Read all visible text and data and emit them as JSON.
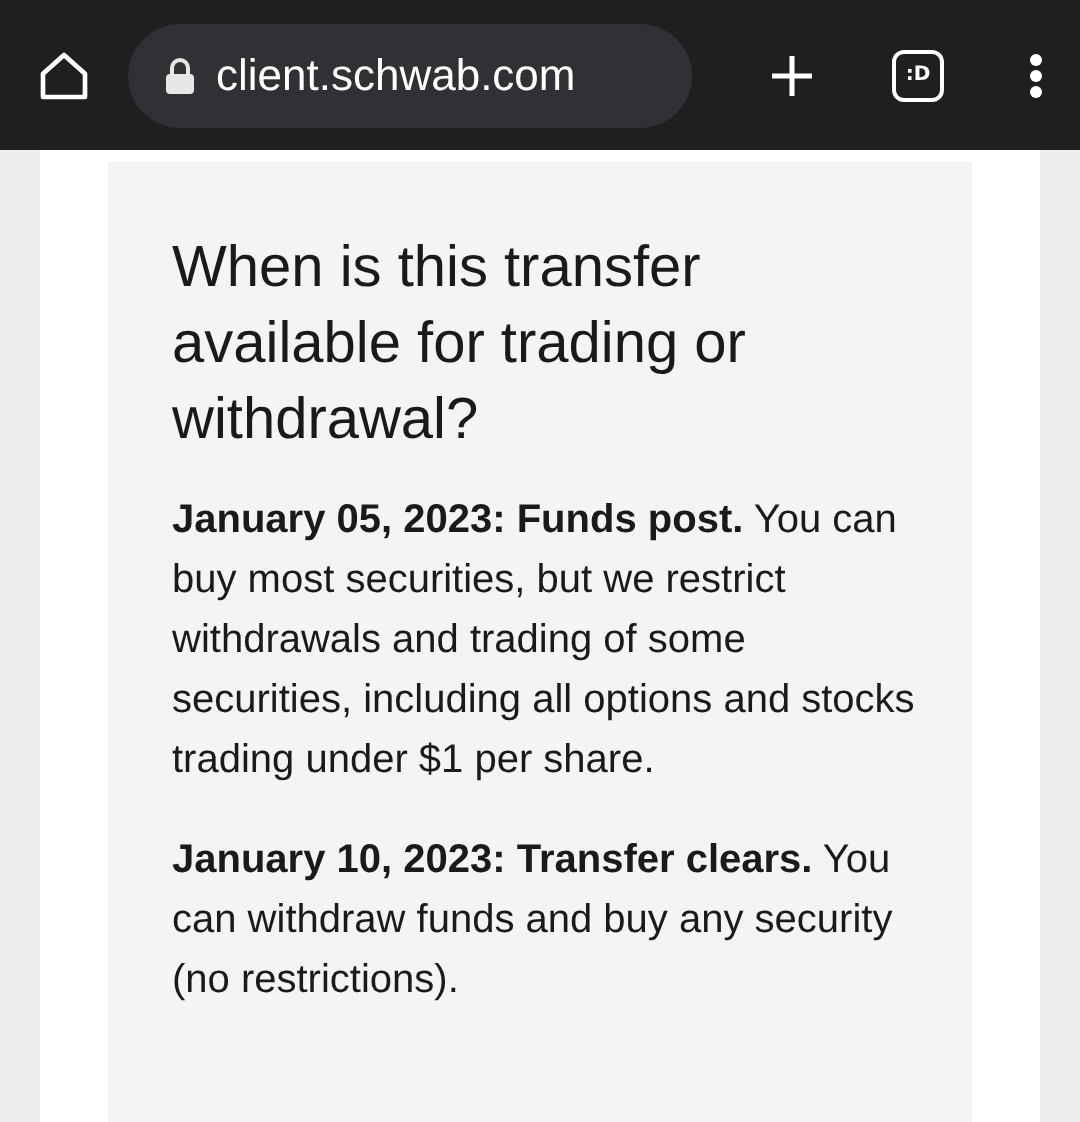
{
  "browser": {
    "url": "client.schwab.com",
    "tab_count": ":D"
  },
  "card": {
    "heading": "When is this transfer available for trading or withdrawal?",
    "paragraphs": [
      "**January 05, 2023: Funds post.** You can buy most securities, but we restrict withdrawals and trading of some securities, including all options and stocks trading under $1 per share.",
      "**January 10, 2023: Transfer clears.** You can withdraw funds and buy any security (no restrictions)."
    ]
  }
}
